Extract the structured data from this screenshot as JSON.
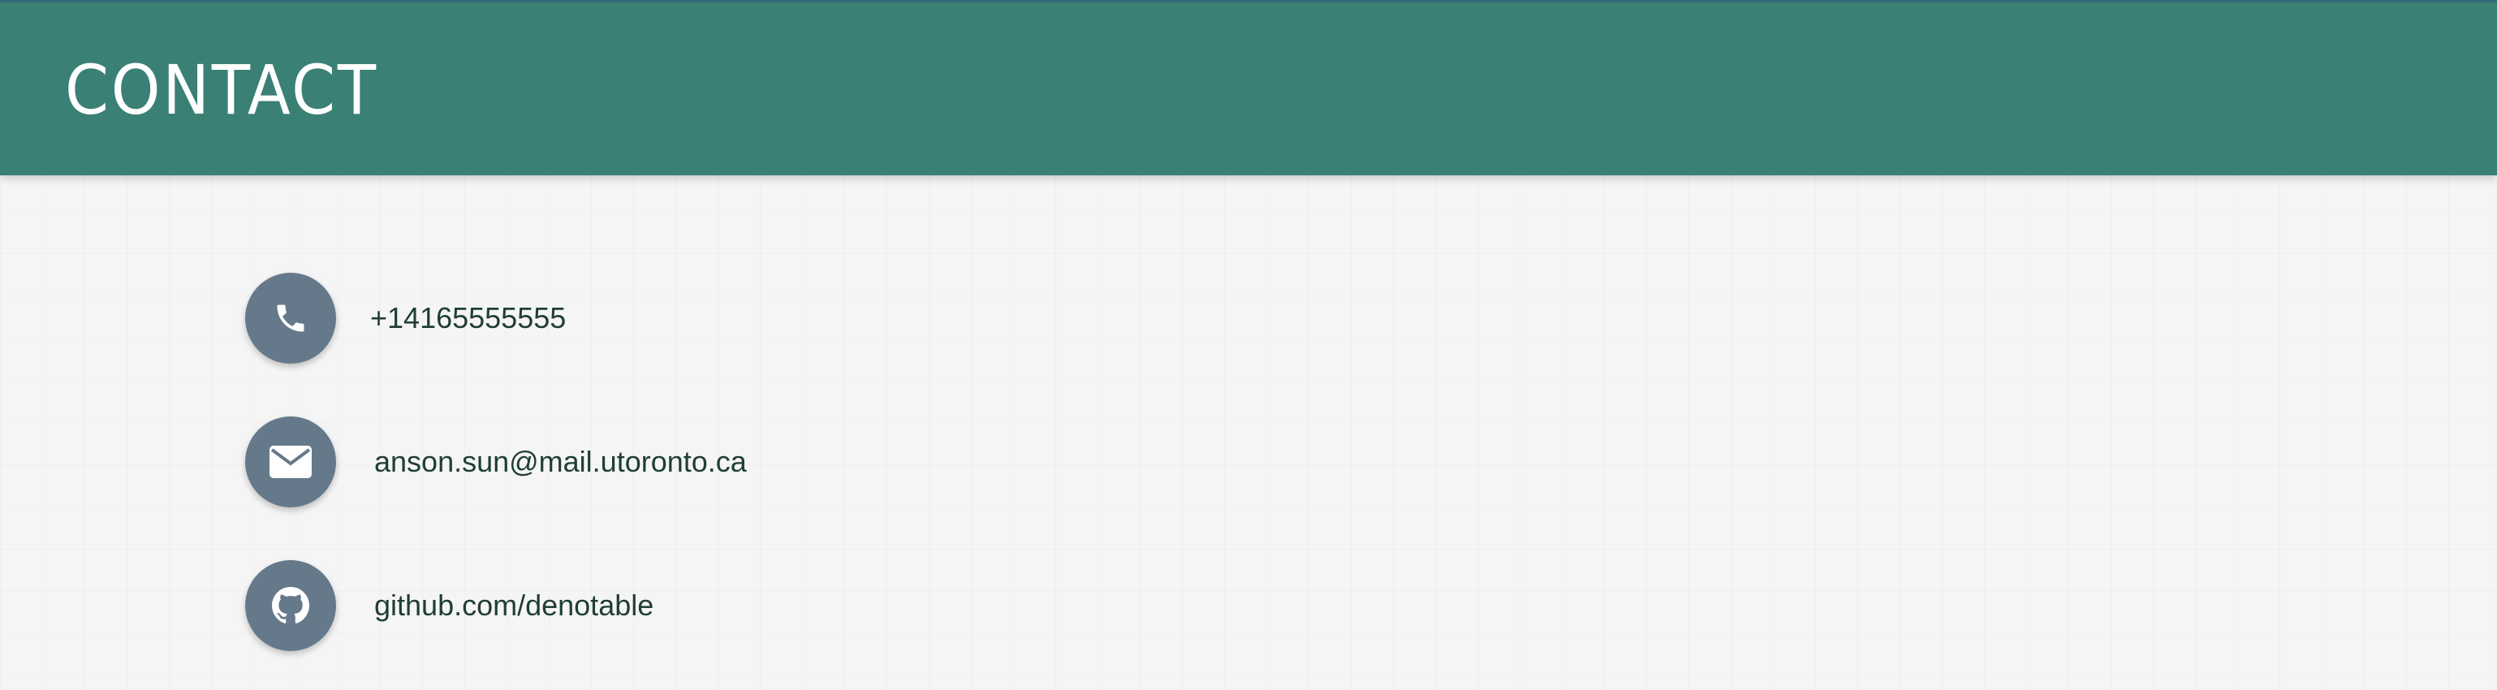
{
  "header": {
    "title": "CONTACT",
    "background_color": "#3a8074"
  },
  "contacts": [
    {
      "icon": "phone-icon",
      "text": "+14165555555"
    },
    {
      "icon": "envelope-icon",
      "text": "anson.sun@mail.utoronto.ca"
    },
    {
      "icon": "github-icon",
      "text": "github.com/denotable"
    }
  ],
  "colors": {
    "icon_circle": "#66798a",
    "text": "#1f3d37",
    "page_background": "#f5f5f5"
  }
}
